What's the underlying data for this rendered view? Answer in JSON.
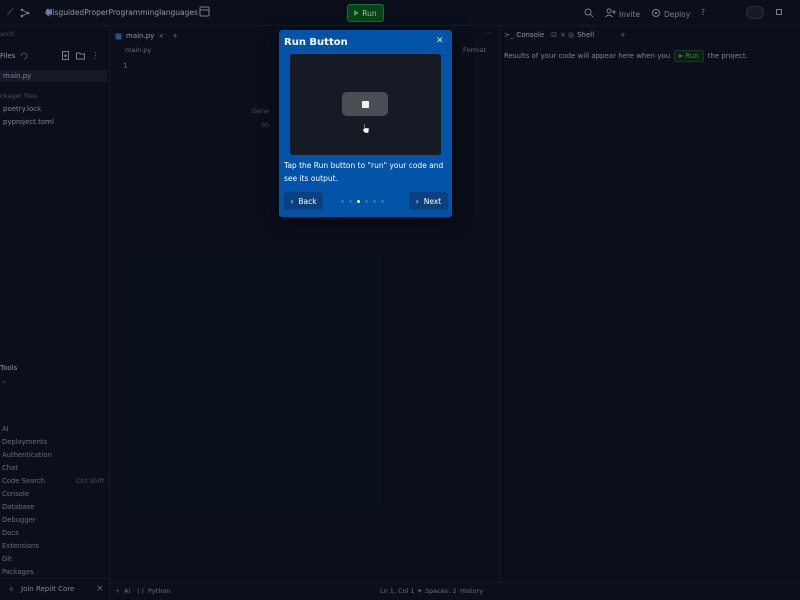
{
  "topbar": {
    "project_name": "MisguidedProperProgramminglanguages",
    "run_label": "Run",
    "invite_label": "Invite",
    "deploy_label": "Deploy",
    "help_label": "?"
  },
  "sidebar": {
    "search_placeholder": "arch",
    "files_label": "Files",
    "active_file": "main.py",
    "packager_label": "ckager files",
    "packager_files": [
      "poetry.lock",
      "pyproject.toml"
    ],
    "tools_label": "Tools",
    "tools": [
      "AI",
      "Deployments",
      "Authentication",
      "Chat",
      "Code Search",
      "Console",
      "Database",
      "Debugger",
      "Docs",
      "Extensions",
      "Git",
      "Packages"
    ],
    "code_search_shortcut": "Ctrl Shift",
    "join_label": "Join Replit Core"
  },
  "editor": {
    "tab_label": "main.py",
    "breadcrumb": "main.py",
    "format_label": "Format",
    "line_number": "1",
    "hint_1": "Gene",
    "hint_2": "Sh"
  },
  "console": {
    "tabs": [
      "Console",
      "Shell"
    ],
    "message_before": "Results of your code will appear here when you",
    "message_run": "Run",
    "message_after": "the project."
  },
  "statusbar": {
    "ai": "AI",
    "language": "Python",
    "position": "Ln 1, Col 1",
    "spaces": "Spaces: 2",
    "history": "History"
  },
  "tutorial": {
    "title": "Run Button",
    "body": "Tap the Run button to \"run\" your code and see its output.",
    "back_label": "Back",
    "next_label": "Next",
    "step_current": 3,
    "step_total": 6
  },
  "colors": {
    "background": "#0e1525",
    "modal": "#0053a6",
    "run_button": "#0b5a1e",
    "run_accent": "#3fb864"
  }
}
